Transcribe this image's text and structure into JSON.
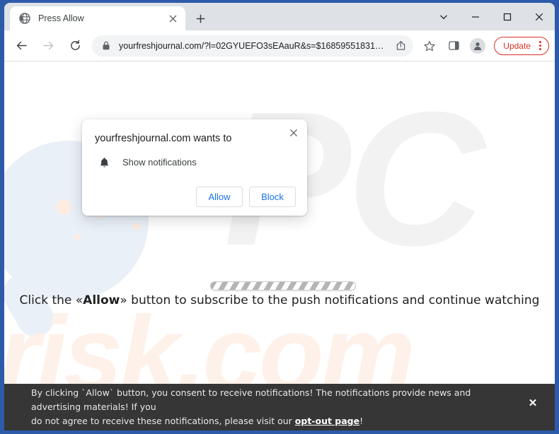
{
  "window": {
    "frame_color": "#2d5ba9",
    "controls": [
      {
        "name": "tab-search",
        "glyph": "chevron-down-icon"
      },
      {
        "name": "minimize",
        "glyph": "minimize-icon"
      },
      {
        "name": "maximize",
        "glyph": "maximize-icon"
      },
      {
        "name": "close",
        "glyph": "close-icon"
      }
    ]
  },
  "tabstrip": {
    "tab": {
      "title": "Press Allow",
      "favicon": "globe-icon",
      "close_label": "×"
    },
    "new_tab_label": "+"
  },
  "toolbar": {
    "back": "back-arrow-icon",
    "forward": "forward-arrow-icon",
    "reload": "reload-icon",
    "lock": "lock-icon",
    "url": "yourfreshjournal.com/?l=02GYUEFO3sEAauR&s=$16859551831…",
    "share": "share-icon",
    "bookmark": "star-icon",
    "side_panel": "side-panel-icon",
    "profile": "profile-avatar-icon",
    "update_label": "Update",
    "update_color": "#d93025",
    "menu": "kebab-menu-icon"
  },
  "permission_dialog": {
    "title": "yourfreshjournal.com wants to",
    "permission_icon": "bell-icon",
    "permission_label": "Show notifications",
    "allow_label": "Allow",
    "block_label": "Block",
    "close_label": "×",
    "link_color": "#1a73e8"
  },
  "page": {
    "watermark_pc": "PC",
    "watermark_risk": "risk.com",
    "loader": "striped-progress-bar",
    "caption_before": "Click the «Allow»",
    "caption_bold": "Allow",
    "caption_prefix": "Click the «",
    "caption_suffix": "» button to subscribe to the push notifications and continue watching"
  },
  "consent_banner": {
    "line1": "By clicking `Allow` button, you consent to receive notifications! The notifications provide news and advertising materials! If you",
    "line2_before": "do not agree to receive these notifications, please visit our ",
    "link": "opt-out page",
    "line2_after": "!",
    "close_label": "✕",
    "background": "#363636"
  }
}
